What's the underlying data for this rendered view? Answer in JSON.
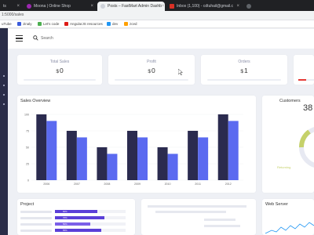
{
  "browser": {
    "tabs": [
      {
        "label": "ts",
        "favicon_color": "#5f6368",
        "active": false
      },
      {
        "label": "Moona | Online Shop",
        "favicon_color": "#9c27b0",
        "active": false
      },
      {
        "label": "Posts – FastMart Admin Dashb",
        "favicon_color": "#e0e0e0",
        "active": true
      },
      {
        "label": "Inbox (1,100) - cdtuhail@gmail.c",
        "favicon_color": "#d93025",
        "active": false
      },
      {
        "label": "",
        "favicon_color": "#5f6368",
        "active": false
      }
    ],
    "address_fragment": "1:5000/sales",
    "bookmarks": [
      {
        "label": "uTube",
        "color": "#ff0000"
      },
      {
        "label": "Jinaly",
        "color": "#3b5bdb"
      },
      {
        "label": "Let's code",
        "color": "#4caf50"
      },
      {
        "label": "AngularJS resources",
        "color": "#dd1b16"
      },
      {
        "label": "dev",
        "color": "#2196f3"
      },
      {
        "label": "zced",
        "color": "#ffa000"
      }
    ]
  },
  "header": {
    "search_placeholder": "Search"
  },
  "stats": [
    {
      "title": "Total Sales",
      "currency": "$",
      "value": "0"
    },
    {
      "title": "Profit",
      "currency": "$",
      "value": "0"
    },
    {
      "title": "Orders",
      "currency": "$",
      "value": "1"
    }
  ],
  "sales_overview": {
    "title": "Sales Overview",
    "chart_data": {
      "type": "bar",
      "categories": [
        "2006",
        "2007",
        "2008",
        "2009",
        "2010",
        "2011",
        "2012"
      ],
      "ylim": [
        0,
        100
      ],
      "yticks": [
        "0",
        "25",
        "50",
        "75",
        "100"
      ],
      "series": [
        {
          "values": [
            100,
            75,
            50,
            75,
            50,
            75,
            100
          ],
          "color": "#2b2b4f"
        },
        {
          "values": [
            90,
            65,
            40,
            65,
            40,
            65,
            90
          ],
          "color": "#5b6af0"
        }
      ]
    }
  },
  "customers": {
    "title": "Customers",
    "value": "38",
    "legend": "Returning"
  },
  "project": {
    "title": "Project",
    "rows": [
      {
        "percent": 60,
        "color": "#5b3fd8"
      },
      {
        "percent": 70,
        "color": "#5b3fd8"
      },
      {
        "percent": 50,
        "color": "#7b5fe8"
      },
      {
        "percent": 65,
        "color": "#5b3fd8"
      }
    ]
  },
  "web_server": {
    "title": "Web Server"
  }
}
